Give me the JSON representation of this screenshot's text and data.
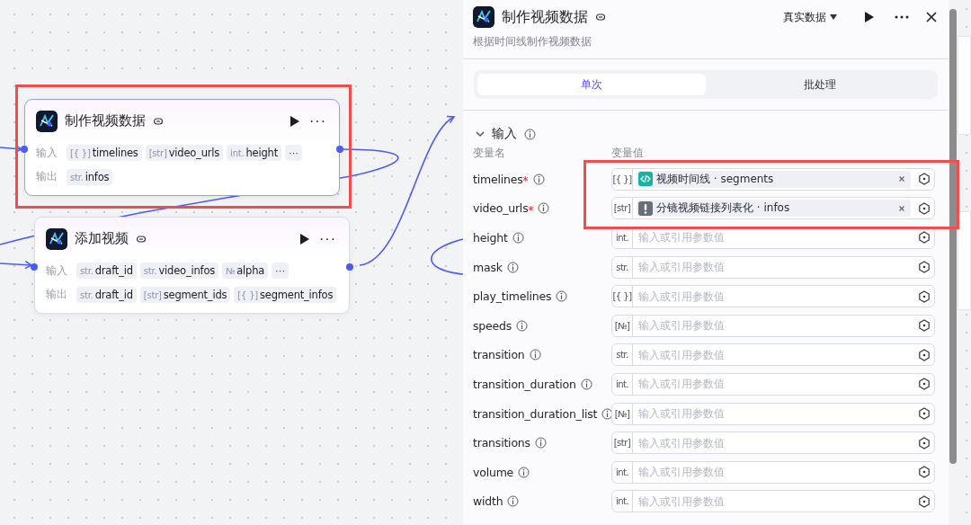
{
  "canvas": {
    "nodes": [
      {
        "title": "制作视频数据",
        "highlighted": true,
        "selected": true,
        "inputs_label": "输入",
        "inputs": [
          {
            "type": "[{ }]",
            "name": "timelines",
            "faded": false
          },
          {
            "type": "[str]",
            "name": "video_urls",
            "faded": false
          },
          {
            "type": "int.",
            "name": "height",
            "faded": false
          }
        ],
        "outputs_label": "输出",
        "outputs": [
          {
            "type": "str.",
            "name": "infos",
            "faded": false
          }
        ],
        "more": "···"
      },
      {
        "title": "添加视频",
        "highlighted": false,
        "selected": false,
        "inputs_label": "输入",
        "inputs": [
          {
            "type": "str.",
            "name": "draft_id",
            "faded": false
          },
          {
            "type": "str.",
            "name": "video_infos",
            "faded": false
          },
          {
            "type": "№",
            "name": "alpha",
            "faded": false
          }
        ],
        "outputs_label": "输出",
        "outputs": [
          {
            "type": "str.",
            "name": "draft_id",
            "faded": false
          },
          {
            "type": "[str]",
            "name": "segment_ids",
            "faded": false
          },
          {
            "type": "[{ }]",
            "name": "segment_infos",
            "faded": false
          }
        ],
        "more": "···"
      }
    ]
  },
  "panel": {
    "title": "制作视频数据",
    "description": "根据时间线制作视频数据",
    "data_mode": "真实数据",
    "tabs": [
      {
        "label": "单次",
        "selected": true
      },
      {
        "label": "批处理",
        "selected": false
      }
    ],
    "section": {
      "title": "输入",
      "expanded": true
    },
    "columns": [
      "变量名",
      "变量值"
    ],
    "params": [
      {
        "name": "timelines",
        "required_mark": "*",
        "type": "[{ }]",
        "value": {
          "kind": "code",
          "text": "视频时间线 · segments"
        },
        "highlighted": true
      },
      {
        "name": "video_urls",
        "required_mark": "*",
        "type": "[str]",
        "value": {
          "kind": "warning",
          "text": "分镜视频链接列表化 · infos"
        },
        "highlighted": true
      },
      {
        "name": "height",
        "type": "int.",
        "placeholder": "输入或引用参数值"
      },
      {
        "name": "mask",
        "type": "str.",
        "placeholder": "输入或引用参数值"
      },
      {
        "name": "play_timelines",
        "type": "[{ }]",
        "placeholder": "输入或引用参数值"
      },
      {
        "name": "speeds",
        "type": "[№]",
        "placeholder": "输入或引用参数值"
      },
      {
        "name": "transition",
        "type": "str.",
        "placeholder": "输入或引用参数值"
      },
      {
        "name": "transition_duration",
        "type": "int.",
        "placeholder": "输入或引用参数值"
      },
      {
        "name": "transition_duration_list",
        "type": "[№]",
        "placeholder": "输入或引用参数值"
      },
      {
        "name": "transitions",
        "type": "[str]",
        "placeholder": "输入或引用参数值"
      },
      {
        "name": "volume",
        "type": "int.",
        "placeholder": "输入或引用参数值"
      },
      {
        "name": "width",
        "type": "int.",
        "placeholder": "输入或引用参数值"
      }
    ]
  }
}
